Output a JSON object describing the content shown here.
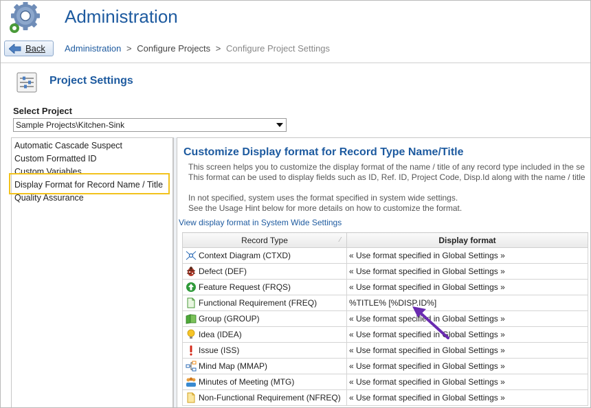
{
  "header": {
    "title": "Administration"
  },
  "toolbar": {
    "back_label": "Back"
  },
  "breadcrumb": {
    "items": [
      "Administration",
      "Configure Projects",
      "Configure Project Settings"
    ],
    "separator": ">"
  },
  "section": {
    "title": "Project Settings"
  },
  "project_select": {
    "label": "Select Project",
    "value": "Sample Projects\\Kitchen-Sink"
  },
  "menu": {
    "items": [
      "Automatic Cascade Suspect",
      "Custom Formatted ID",
      "Custom Variables",
      "Display Format for Record Name / Title",
      "Quality Assurance"
    ],
    "selected_index": 3
  },
  "content": {
    "title": "Customize Display format for Record Type Name/Title",
    "desc_lines": [
      "This screen helps you to customize the display format of the name / title of any record type included in the se",
      "This format can be used to display fields such as ID, Ref. ID, Project Code, Disp.Id along with the name / title",
      "In not specified, system uses the format specified in system wide settings.",
      "See the Usage Hint below for more details on how to customize the format."
    ],
    "link": "View display format in System Wide Settings"
  },
  "table": {
    "headers": [
      "Record Type",
      "Display format"
    ],
    "rows": [
      {
        "type": "Context Diagram (CTXD)",
        "format": "« Use format specified in Global Settings »",
        "icon": "context-diagram-icon"
      },
      {
        "type": "Defect (DEF)",
        "format": "« Use format specified in Global Settings »",
        "icon": "defect-icon"
      },
      {
        "type": "Feature Request (FRQS)",
        "format": "« Use format specified in Global Settings »",
        "icon": "feature-request-icon"
      },
      {
        "type": "Functional Requirement (FREQ)",
        "format": "%TITLE% [%DISP.ID%]",
        "icon": "functional-requirement-icon"
      },
      {
        "type": "Group (GROUP)",
        "format": "« Use format specified in Global Settings »",
        "icon": "group-icon"
      },
      {
        "type": "Idea (IDEA)",
        "format": "« Use format specified in Global Settings »",
        "icon": "idea-icon"
      },
      {
        "type": "Issue (ISS)",
        "format": "« Use format specified in Global Settings »",
        "icon": "issue-icon"
      },
      {
        "type": "Mind Map (MMAP)",
        "format": "« Use format specified in Global Settings »",
        "icon": "mind-map-icon"
      },
      {
        "type": "Minutes of Meeting (MTG)",
        "format": "« Use format specified in Global Settings »",
        "icon": "minutes-of-meeting-icon"
      },
      {
        "type": "Non-Functional Requirement (NFREQ)",
        "format": "« Use format specified in Global Settings »",
        "icon": "non-functional-requirement-icon"
      }
    ]
  },
  "colors": {
    "accent": "#1d5a9f",
    "highlight": "#f2c21b",
    "annotation": "#6a2bb0"
  }
}
